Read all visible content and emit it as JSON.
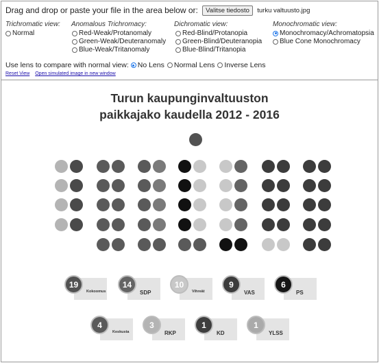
{
  "toolbar": {
    "drag_text": "Drag and drop or paste your file in the area below or:",
    "file_button": "Valitse tiedosto",
    "file_name": "turku valtuusto.jpg"
  },
  "views": {
    "trichromatic": {
      "heading": "Trichromatic view:",
      "options": [
        "Normal"
      ]
    },
    "anomalous": {
      "heading": "Anomalous Trichromacy:",
      "options": [
        "Red-Weak/Protanomaly",
        "Green-Weak/Deuteranomaly",
        "Blue-Weak/Tritanomaly"
      ]
    },
    "dichromatic": {
      "heading": "Dichromatic view:",
      "options": [
        "Red-Blind/Protanopia",
        "Green-Blind/Deuteranopia",
        "Blue-Blind/Tritanopia"
      ]
    },
    "monochromatic": {
      "heading": "Monochromatic view:",
      "options": [
        "Monochromacy/Achromatopsia",
        "Blue Cone Monochromacy"
      ],
      "selected": "Monochromacy/Achromatopsia"
    }
  },
  "lens": {
    "label": "Use lens to compare with normal view:",
    "options": [
      "No Lens",
      "Normal Lens",
      "Inverse Lens"
    ],
    "selected": "No Lens"
  },
  "links": {
    "reset": "Reset View",
    "open_new": "Open simulated image in new window"
  },
  "image": {
    "title_line1": "Turun kaupunginvaltuuston",
    "title_line2": "paikkajako kaudella 2012 - 2016",
    "legend": [
      {
        "count": "19",
        "party": "Kokoomus",
        "color": "#525252"
      },
      {
        "count": "14",
        "party": "SDP",
        "color": "#646464"
      },
      {
        "count": "10",
        "party": "Vihreät",
        "color": "#c8c8c8"
      },
      {
        "count": "9",
        "party": "VAS",
        "color": "#3c3c3c"
      },
      {
        "count": "6",
        "party": "PS",
        "color": "#161616"
      },
      {
        "count": "4",
        "party": "Keskusta",
        "color": "#5a5a5a"
      },
      {
        "count": "3",
        "party": "RKP",
        "color": "#b4b4b4"
      },
      {
        "count": "1",
        "party": "KD",
        "color": "#3e3e3e"
      },
      {
        "count": "1",
        "party": "YLSS",
        "color": "#aaaaaa"
      }
    ],
    "seat_rows": [
      [
        "#525252"
      ],
      [
        "#b4b4b4",
        "#4a4a4a",
        "#5a5a5a",
        "#5a5a5a",
        "#5a5a5a",
        "#7a7a7a",
        "#111111",
        "#c8c8c8",
        "#c8c8c8",
        "#646464",
        "#3c3c3c",
        "#3c3c3c",
        "#3c3c3c",
        "#3c3c3c"
      ],
      [
        "#b4b4b4",
        "#4a4a4a",
        "#5a5a5a",
        "#5a5a5a",
        "#5a5a5a",
        "#7a7a7a",
        "#111111",
        "#c8c8c8",
        "#c8c8c8",
        "#646464",
        "#3c3c3c",
        "#3c3c3c",
        "#3c3c3c",
        "#3c3c3c"
      ],
      [
        "#b4b4b4",
        "#4a4a4a",
        "#5a5a5a",
        "#5a5a5a",
        "#5a5a5a",
        "#7a7a7a",
        "#111111",
        "#c8c8c8",
        "#c8c8c8",
        "#646464",
        "#3c3c3c",
        "#3c3c3c",
        "#3c3c3c",
        "#3c3c3c"
      ],
      [
        "#b4b4b4",
        "#4a4a4a",
        "#5a5a5a",
        "#5a5a5a",
        "#5a5a5a",
        "#7a7a7a",
        "#111111",
        "#c8c8c8",
        "#c8c8c8",
        "#646464",
        "#3c3c3c",
        "#3c3c3c",
        "#3c3c3c",
        "#3c3c3c"
      ],
      [
        "#5a5a5a",
        "#5a5a5a",
        "#5a5a5a",
        "#5a5a5a",
        "#5a5a5a",
        "#5a5a5a",
        "#111111",
        "#111111",
        "#c8c8c8",
        "#c8c8c8",
        "#3c3c3c",
        "#3c3c3c"
      ]
    ]
  }
}
